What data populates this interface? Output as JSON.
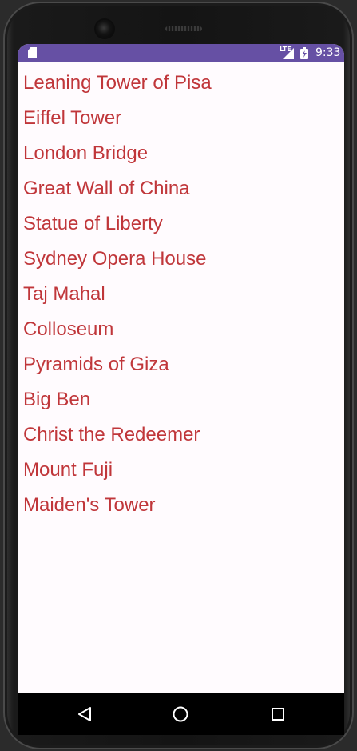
{
  "status_bar": {
    "network": "LTE",
    "time": "9:33"
  },
  "landmarks": [
    "Leaning Tower of Pisa",
    "Eiffel Tower",
    "London Bridge",
    "Great Wall of China",
    "Statue of Liberty",
    "Sydney Opera House",
    "Taj Mahal",
    "Colloseum",
    "Pyramids of Giza",
    "Big Ben",
    "Christ the Redeemer",
    "Mount Fuji",
    "Maiden's Tower"
  ],
  "colors": {
    "status_bar": "#6650a4",
    "list_text": "#c0363a",
    "background": "#fffbfe",
    "nav_bar": "#000000"
  },
  "icons": {
    "status": [
      "sd-card-icon",
      "lte-signal-icon",
      "battery-charging-icon"
    ],
    "nav": [
      "back-triangle-icon",
      "home-circle-icon",
      "recents-square-icon"
    ]
  }
}
